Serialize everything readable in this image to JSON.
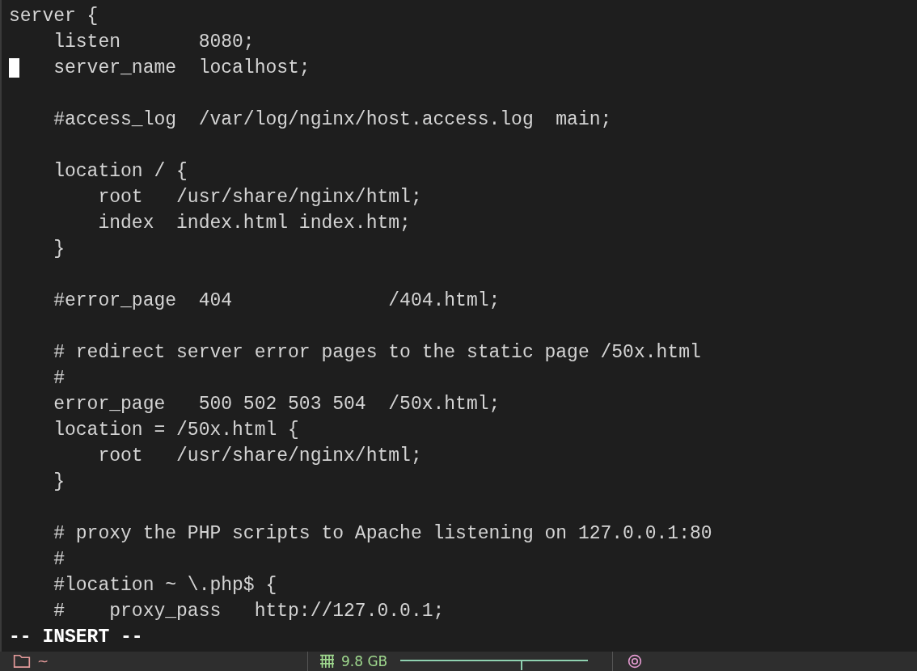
{
  "editor": {
    "blocks": [
      [
        "server {",
        "    listen       8080;",
        {
          "text": "    server_name  localhost;",
          "cursor": true
        }
      ],
      [
        "    #access_log  /var/log/nginx/host.access.log  main;"
      ],
      [
        "    location / {",
        "        root   /usr/share/nginx/html;",
        "        index  index.html index.htm;",
        "    }"
      ],
      [
        "    #error_page  404              /404.html;"
      ],
      [
        "    # redirect server error pages to the static page /50x.html",
        "    #",
        "    error_page   500 502 503 504  /50x.html;",
        "    location = /50x.html {",
        "        root   /usr/share/nginx/html;",
        "    }"
      ],
      [
        "    # proxy the PHP scripts to Apache listening on 127.0.0.1:80",
        "    #",
        "    #location ~ \\.php$ {",
        "    #    proxy_pass   http://127.0.0.1;"
      ]
    ],
    "mode": "-- INSERT --"
  },
  "status_bar": {
    "directory": "~",
    "memory": "9.8 GB"
  }
}
